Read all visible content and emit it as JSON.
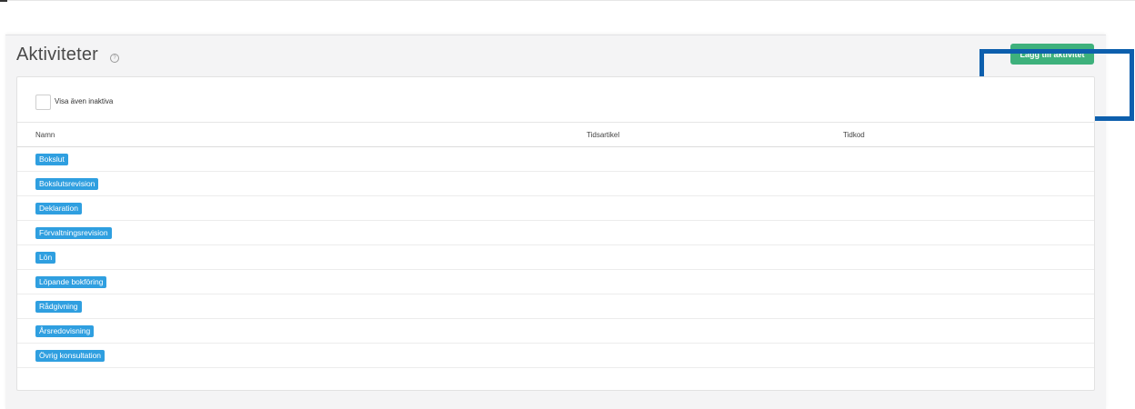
{
  "header": {
    "title": "Aktiviteter",
    "help_glyph": "?",
    "add_button_label": "Lägg till aktivitet"
  },
  "filter": {
    "show_inactive_label": "Visa även inaktiva",
    "show_inactive_checked": false
  },
  "table": {
    "columns": [
      "Namn",
      "Tidsartikel",
      "Tidkod"
    ],
    "rows": [
      {
        "name": "Bokslut",
        "tidsartikel": "",
        "tidkod": ""
      },
      {
        "name": "Bokslutsrevision",
        "tidsartikel": "",
        "tidkod": ""
      },
      {
        "name": "Deklaration",
        "tidsartikel": "",
        "tidkod": ""
      },
      {
        "name": "Förvaltningsrevision",
        "tidsartikel": "",
        "tidkod": ""
      },
      {
        "name": "Lön",
        "tidsartikel": "",
        "tidkod": ""
      },
      {
        "name": "Löpande bokföring",
        "tidsartikel": "",
        "tidkod": ""
      },
      {
        "name": "Rådgivning",
        "tidsartikel": "",
        "tidkod": ""
      },
      {
        "name": "Årsredovisning",
        "tidsartikel": "",
        "tidkod": ""
      },
      {
        "name": "Övrig konsultation",
        "tidsartikel": "",
        "tidkod": ""
      }
    ]
  },
  "colors": {
    "accent_green": "#3eb17c",
    "tag_blue": "#2f9fe0",
    "highlight_blue": "#0d5fad",
    "page_bg": "#f4f4f5"
  }
}
